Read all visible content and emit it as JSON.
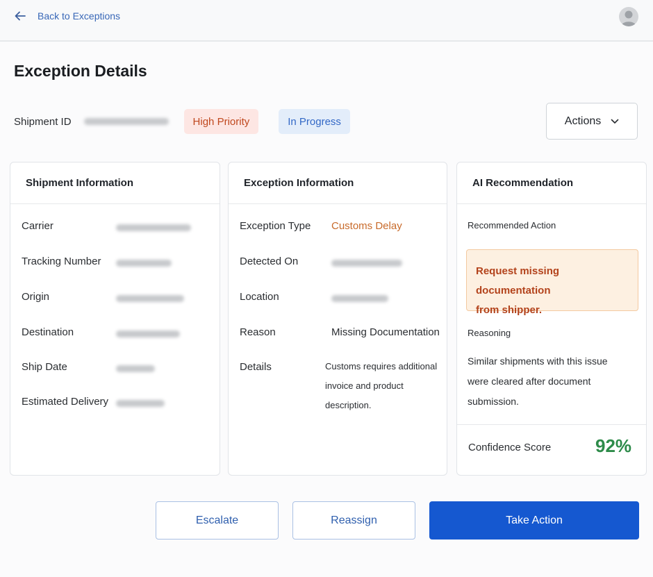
{
  "header": {
    "back_label": "Back to Exceptions"
  },
  "page": {
    "title": "Exception Details",
    "shipment_id_label": "Shipment ID",
    "badges": {
      "priority": "High Priority",
      "status": "In Progress"
    },
    "actions_label": "Actions"
  },
  "shipment_info": {
    "title": "Shipment Information",
    "fields": [
      {
        "label": "Carrier"
      },
      {
        "label": "Tracking Number"
      },
      {
        "label": "Origin"
      },
      {
        "label": "Destination"
      },
      {
        "label": "Ship Date"
      },
      {
        "label": "Estimated Delivery"
      }
    ]
  },
  "exception_info": {
    "title": "Exception Information",
    "exception_type_label": "Exception Type",
    "exception_type_value": "Customs Delay",
    "detected_on_label": "Detected On",
    "location_label": "Location",
    "reason_label": "Reason",
    "reason_value": "Missing Documentation",
    "details_label": "Details",
    "details_lines": [
      "Customs requires additional",
      "invoice and product",
      "description."
    ]
  },
  "ai_recommendation": {
    "title": "AI Recommendation",
    "recommended_action_label": "Recommended Action",
    "recommended_action_lines": [
      "Request missing documentation",
      "from shipper."
    ],
    "reasoning_label": "Reasoning",
    "reasoning_lines": [
      "Similar shipments with this issue",
      "were cleared after document",
      "submission."
    ],
    "confidence_label": "Confidence Score",
    "confidence_value": "92%"
  },
  "footer": {
    "escalate_label": "Escalate",
    "reassign_label": "Reassign",
    "take_action_label": "Take Action"
  },
  "colors": {
    "primary": "#1558d0",
    "priority_badge_bg": "#fde6e3",
    "priority_badge_text": "#c0481e",
    "status_badge_bg": "#e3edfa",
    "status_badge_text": "#3368c6",
    "confidence_text": "#2e8b4a",
    "recommendation_bg": "#fdf0e1"
  }
}
